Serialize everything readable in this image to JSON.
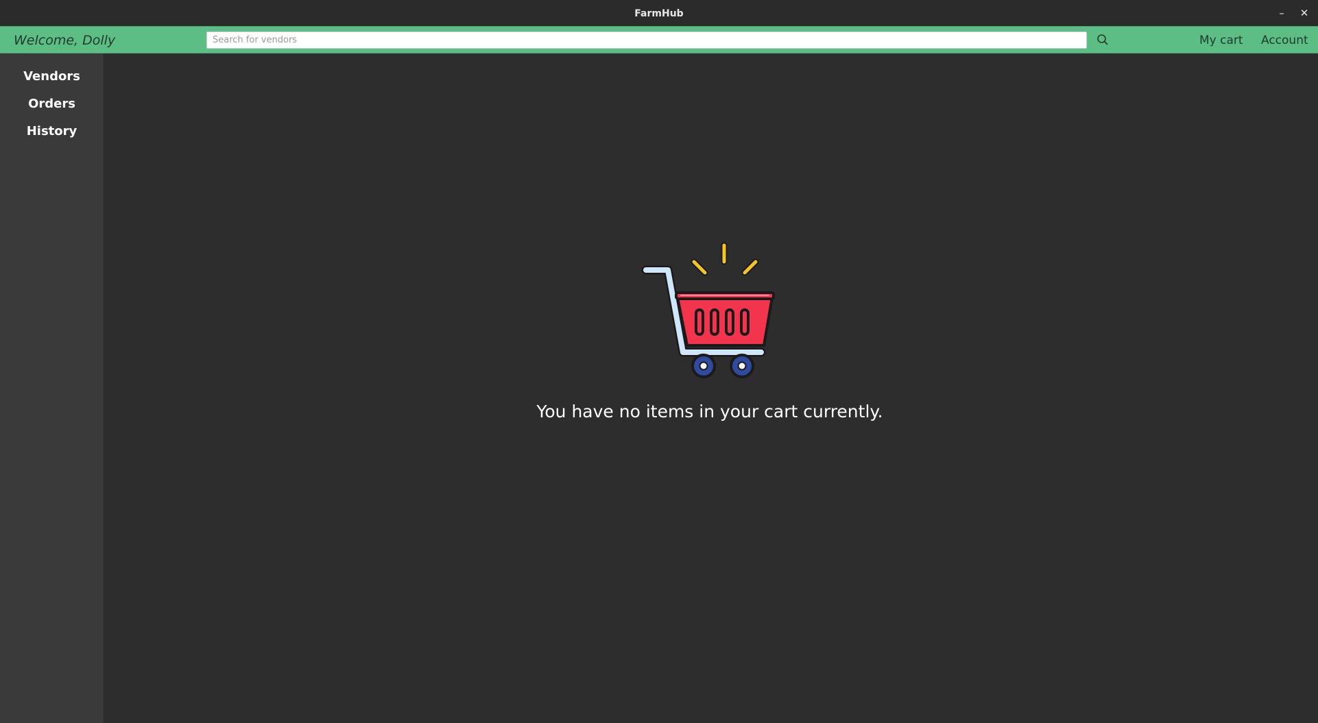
{
  "window": {
    "title": "FarmHub",
    "minimize_label": "–",
    "close_label": "✕"
  },
  "header": {
    "welcome": "Welcome, Dolly",
    "search": {
      "placeholder": "Search for vendors",
      "value": ""
    },
    "search_icon": "search-icon",
    "my_cart_label": "My cart",
    "account_label": "Account",
    "background_color": "#5cbd85"
  },
  "sidebar": {
    "items": [
      {
        "label": "Vendors"
      },
      {
        "label": "Orders"
      },
      {
        "label": "History"
      }
    ]
  },
  "main": {
    "illustration_icon": "shopping-cart-icon",
    "empty_message": "You have no items in your cart currently.",
    "colors": {
      "basket": "#f2354d",
      "frame": "#cfe6fb",
      "wheels": "#2f4a9e",
      "sparkle": "#f5c623"
    }
  }
}
